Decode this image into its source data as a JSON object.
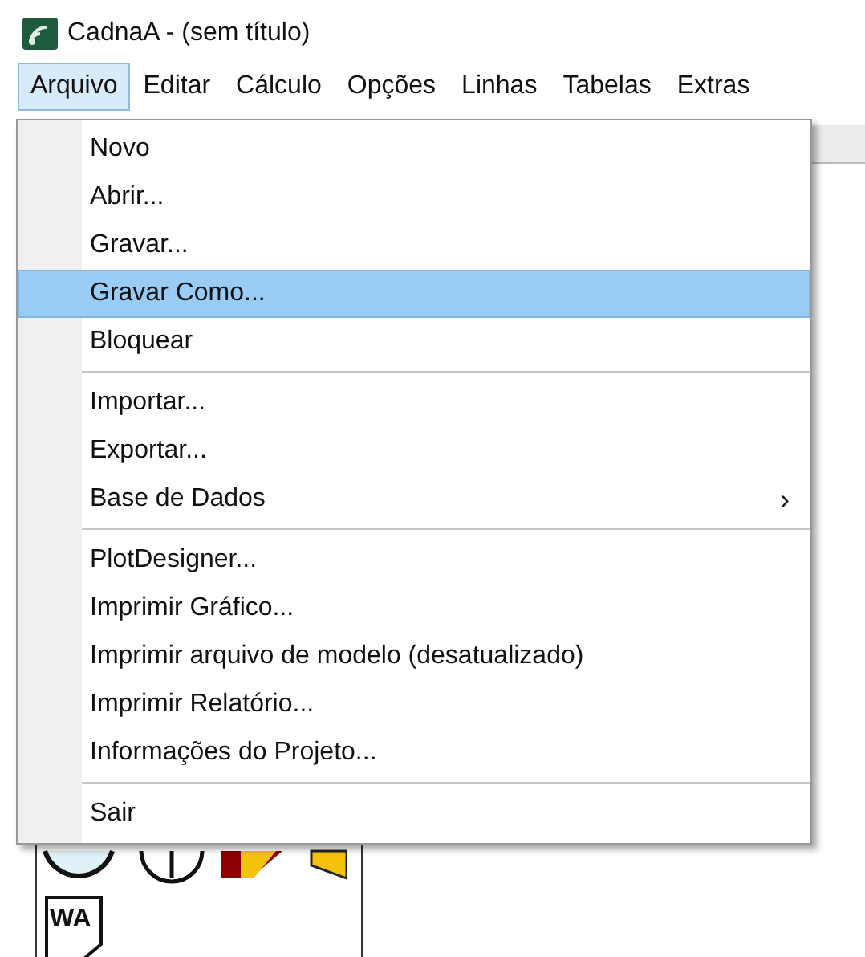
{
  "window": {
    "title": "CadnaA - (sem título)"
  },
  "menu_bar": [
    {
      "label": "Arquivo",
      "selected": true
    },
    {
      "label": "Editar",
      "selected": false
    },
    {
      "label": "Cálculo",
      "selected": false
    },
    {
      "label": "Opções",
      "selected": false
    },
    {
      "label": "Linhas",
      "selected": false
    },
    {
      "label": "Tabelas",
      "selected": false
    },
    {
      "label": "Extras",
      "selected": false
    }
  ],
  "menu": [
    {
      "kind": "item",
      "label": "Novo",
      "selected": false
    },
    {
      "kind": "item",
      "label": "Abrir...",
      "selected": false
    },
    {
      "kind": "item",
      "label": "Gravar...",
      "selected": false
    },
    {
      "kind": "item",
      "label": "Gravar Como...",
      "selected": true
    },
    {
      "kind": "item",
      "label": "Bloquear",
      "selected": false
    },
    {
      "kind": "separator"
    },
    {
      "kind": "item",
      "label": "Importar...",
      "selected": false
    },
    {
      "kind": "item",
      "label": "Exportar...",
      "selected": false
    },
    {
      "kind": "submenu",
      "label": "Base de Dados",
      "selected": false,
      "arrow": "›"
    },
    {
      "kind": "separator"
    },
    {
      "kind": "item",
      "label": "PlotDesigner...",
      "selected": false
    },
    {
      "kind": "item",
      "label": "Imprimir Gráfico...",
      "selected": false
    },
    {
      "kind": "item",
      "label": "Imprimir arquivo de modelo (desatualizado)",
      "selected": false
    },
    {
      "kind": "item",
      "label": "Imprimir Relatório...",
      "selected": false
    },
    {
      "kind": "item",
      "label": "Informações do Projeto...",
      "selected": false
    },
    {
      "kind": "separator"
    },
    {
      "kind": "item",
      "label": "Sair",
      "selected": false
    }
  ],
  "palette": {
    "tool_label": "WA"
  }
}
